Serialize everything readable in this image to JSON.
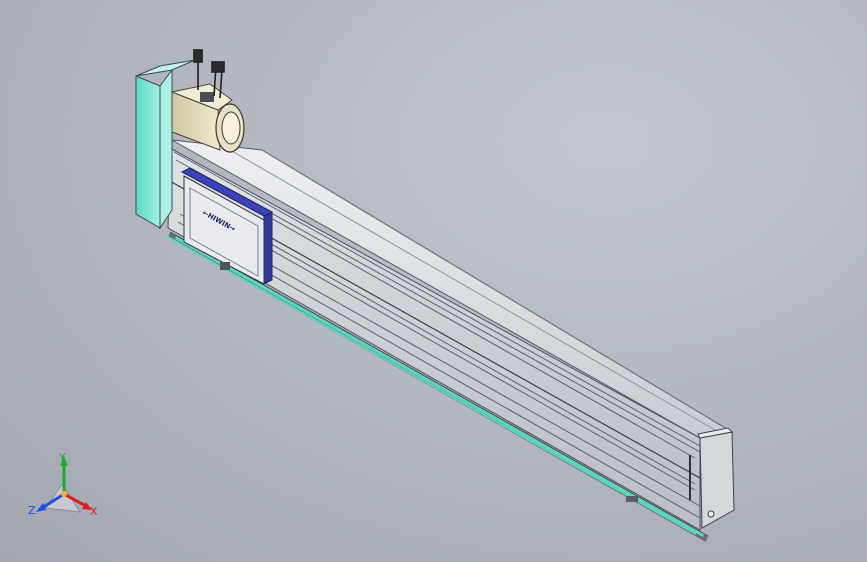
{
  "model": {
    "carriage_logo_text": "←HIWIN→"
  },
  "triad": {
    "x_label": "X",
    "y_label": "Y",
    "z_label": "Z",
    "x_color": "#e02020",
    "y_color": "#18b030",
    "z_color": "#2050e0"
  },
  "colors": {
    "background": "#b6bbc3",
    "motor_bracket": "#7de6d4",
    "rail_body": "#d6d9de",
    "carriage_plate": "#e8eaef",
    "carriage_edge": "#3a44b8",
    "base_strip": "#5fd6c2"
  }
}
